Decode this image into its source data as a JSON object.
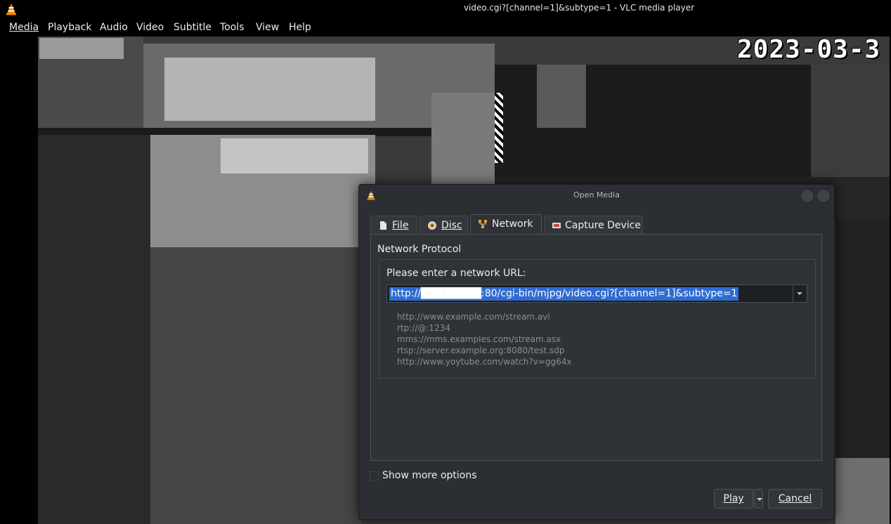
{
  "window": {
    "title": "video.cgi?[channel=1]&subtype=1 - VLC media player"
  },
  "menu": [
    "Media",
    "Playback",
    "Audio",
    "Video",
    "Subtitle",
    "Tools",
    "View",
    "Help"
  ],
  "video": {
    "timestamp": "2023-03-3"
  },
  "dialog": {
    "title": "Open Media",
    "tabs": [
      "File",
      "Disc",
      "Network",
      "Capture Device"
    ],
    "active_tab": "Network",
    "section_title": "Network Protocol",
    "url_prompt": "Please enter a network URL:",
    "url_value": "http://████████:80/cgi-bin/mjpg/video.cgi?[channel=1]&subtype=1",
    "examples": [
      "http://www.example.com/stream.avi",
      "rtp://@:1234",
      "mms://mms.examples.com/stream.asx",
      "rtsp://server.example.org:8080/test.sdp",
      "http://www.yoytube.com/watch?v=gg64x"
    ],
    "show_more_options": "Show more options",
    "show_more_checked": false,
    "play_button": "Play",
    "cancel_button": "Cancel"
  },
  "colors": {
    "selection": "#2f6bd0",
    "dialog_bg": "#2b2e33",
    "vlc_orange": "#f08a00"
  }
}
